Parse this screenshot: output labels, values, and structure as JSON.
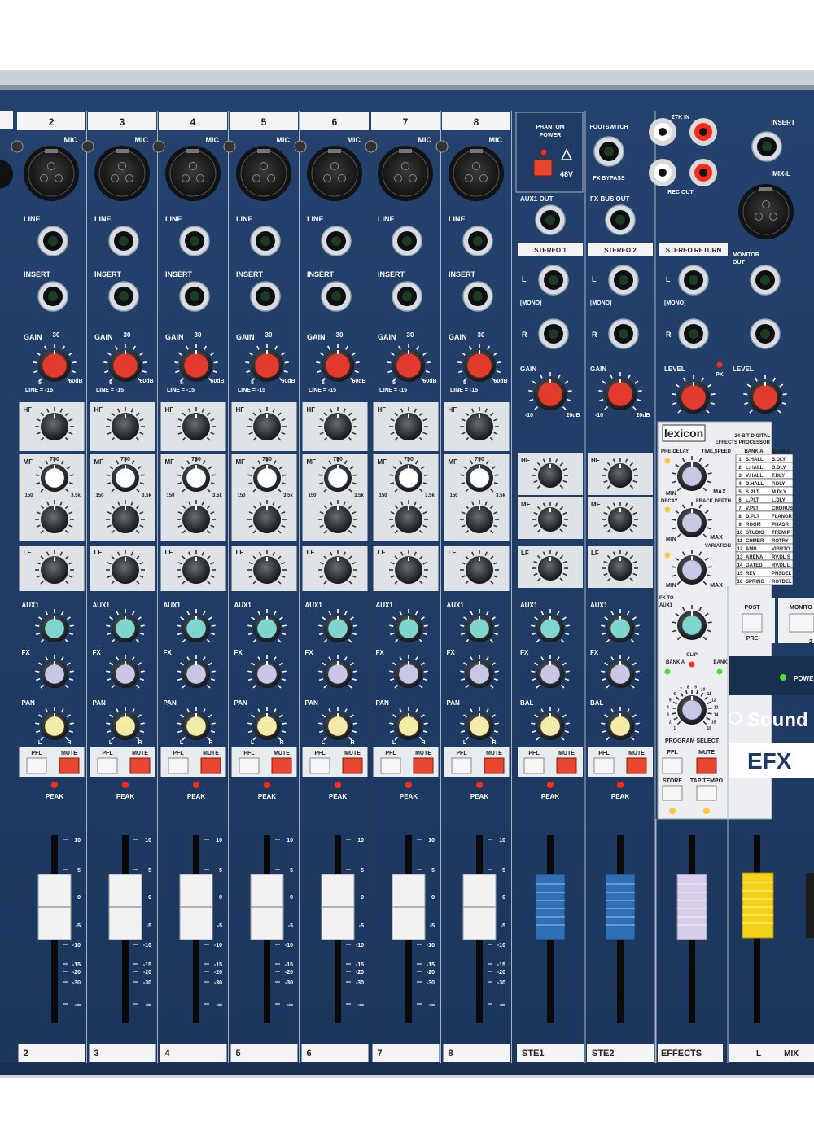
{
  "colors": {
    "panel": "#1f3a63",
    "panel_dark": "#173050",
    "panel_edge": "#cfd6de",
    "white_label": "#f4f4f4",
    "eq_panel": "#dfe3e8",
    "gain_knob": "#e23a2c",
    "aux_knob": "#7fd6cf",
    "fx_knob": "#c9c7e6",
    "pan_knob": "#f3eba8",
    "mute": "#e8462f",
    "fader_white": "#f2f2f2",
    "fader_blue": "#2f6fb6",
    "fader_lilac": "#d7cfe9",
    "fader_yellow": "#f4d21a",
    "led_red": "#ff2a1a",
    "led_green": "#4fdc3c",
    "led_amber": "#ffc83a"
  },
  "mono_channels": [
    "2",
    "3",
    "4",
    "5",
    "6",
    "7",
    "8"
  ],
  "labels": {
    "mic": "MIC",
    "line": "LINE",
    "insert": "INSERT",
    "gain": "GAIN",
    "gain_top": "30",
    "gain_min": "5",
    "gain_max": "60dB",
    "line_note": "LINE = -15",
    "hf": "HF",
    "mf": "MF",
    "lf": "LF",
    "mf_freq_top": "750",
    "mf_freq_min": "150",
    "mf_freq_max": "3.5k",
    "aux1": "AUX1",
    "fx": "FX",
    "pan": "PAN",
    "bal": "BAL",
    "pfl": "PFL",
    "mute": "MUTE",
    "peak": "PEAK",
    "l": "L",
    "r": "R",
    "mono": "[MONO]",
    "level": "LEVEL",
    "pk": "PK",
    "gain_min_st": "-10",
    "gain_max_st": "20dB"
  },
  "fader_scale": [
    "10",
    "5",
    "0",
    "-5",
    "-10",
    "-15",
    "-20",
    "-30",
    "-∞"
  ],
  "stereo_channels": [
    {
      "name": "STE1",
      "header": "STEREO 1",
      "out_label": "AUX1 OUT"
    },
    {
      "name": "STE2",
      "header": "STEREO 2",
      "out_label": "FX BUS OUT"
    }
  ],
  "stereo_return": {
    "header": "STEREO RETURN"
  },
  "top_section": {
    "phantom": "PHANTOM POWER",
    "v48": "48V",
    "footswitch": "FOOTSWITCH",
    "fx_bypass": "FX BYPASS",
    "tk_in": "2TK IN",
    "rec_out": "REC OUT",
    "insert": "INSERT",
    "mix_l": "MIX-L",
    "monitor_out": "MONITOR OUT"
  },
  "lexicon": {
    "brand": "lexicon",
    "sub1": "24-BIT DIGITAL",
    "sub2": "EFFECTS PROCESSOR",
    "pre_delay": "PRE-DELAY",
    "time_speed": "TIME,SPEED",
    "decay": "DECAY",
    "fback_depth": "FBACK,DEPTH",
    "variation": "VARIATION",
    "min": "MIN",
    "max": "MAX",
    "fx_to_aux1": "FX TO AUX1",
    "bank_a": "BANK A",
    "bank_b": "BANK B",
    "clip": "CLIP",
    "program_select": "PROGRAM SELECT",
    "store": "STORE",
    "tap_tempo": "TAP TEMPO",
    "pfl": "PFL",
    "mute": "MUTE",
    "program_table": [
      [
        "1",
        "S.HALL",
        "S.DLY"
      ],
      [
        "2",
        "L.HALL",
        "D.DLY"
      ],
      [
        "3",
        "V.HALL",
        "T.DLY"
      ],
      [
        "4",
        "D.HALL",
        "P.DLY"
      ],
      [
        "5",
        "S.PLT",
        "M.DLY"
      ],
      [
        "6",
        "L.PLT",
        "L.DLY"
      ],
      [
        "7",
        "V.PLT",
        "CHORUS"
      ],
      [
        "8",
        "D.PLT",
        "FLANGR"
      ],
      [
        "9",
        "ROOM",
        "PHASR"
      ],
      [
        "10",
        "STUDIO",
        "TREM.P"
      ],
      [
        "11",
        "CHMBR",
        "ROTRY"
      ],
      [
        "12",
        "AMB",
        "VIBRTO"
      ],
      [
        "13",
        "ARENA",
        "RV.DL S"
      ],
      [
        "14",
        "GATED",
        "RV.DL L"
      ],
      [
        "15",
        "REV",
        "PHSDEL"
      ],
      [
        "16",
        "SPRING",
        "ROTDEL"
      ]
    ],
    "program_numbers": [
      "1",
      "2",
      "3",
      "4",
      "5",
      "6",
      "7",
      "8",
      "9",
      "10",
      "11",
      "12",
      "13",
      "14",
      "15",
      "16"
    ]
  },
  "master": {
    "post": "POST",
    "pre": "PRE",
    "monitor": "MONITO",
    "power": "POWER",
    "brand": "Sound",
    "model": "EFX",
    "mix_l": "L",
    "mix": "MIX",
    "effects": "EFFECTS",
    "two": "2"
  }
}
